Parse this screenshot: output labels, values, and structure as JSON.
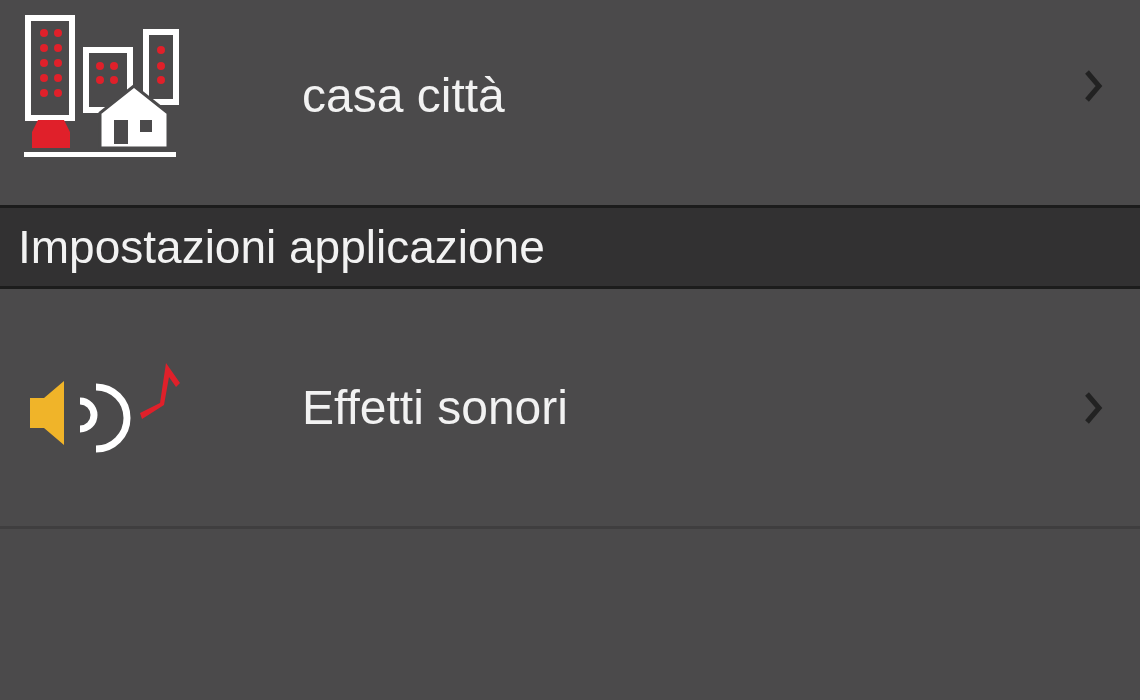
{
  "rows_top": [
    {
      "kind": "city",
      "label": "casa città"
    }
  ],
  "section": {
    "title": "Impostazioni applicazione"
  },
  "rows": [
    {
      "kind": "sound",
      "label": "Effetti sonori"
    }
  ]
}
